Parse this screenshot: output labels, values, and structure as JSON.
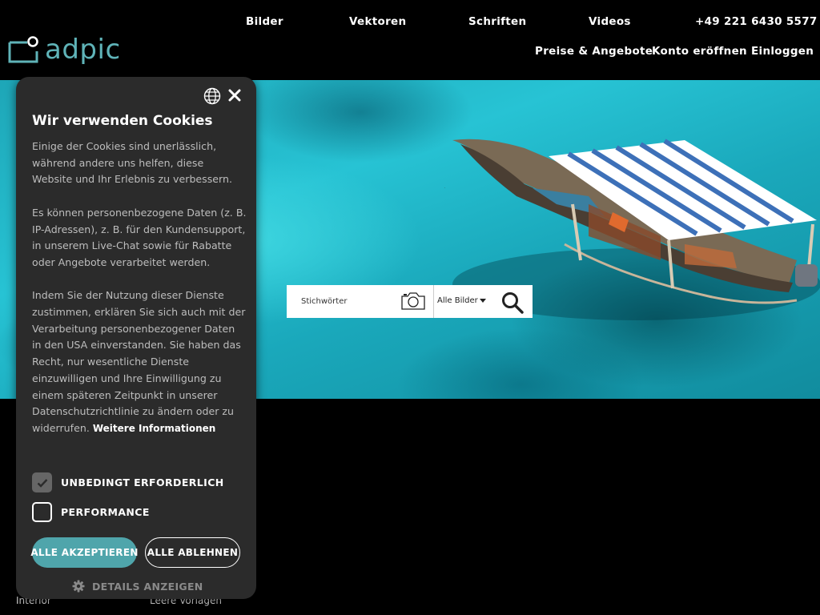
{
  "header": {
    "logo_text": "adpic",
    "nav_top": [
      "Bilder",
      "Vektoren",
      "Schriften",
      "Videos",
      "+49 221 6430 5577"
    ],
    "nav_bottom": [
      "Preise & Angebote",
      "Konto eröffnen",
      "Einloggen"
    ]
  },
  "search": {
    "placeholder": "Stichwörter",
    "category": "Alle Bilder"
  },
  "bottom_links": [
    "Interior",
    "Leere Vorlagen"
  ],
  "cookie": {
    "title": "Wir verwenden Cookies",
    "paragraph1": "Einige der Cookies sind unerlässlich, während andere uns helfen, diese Website und Ihr Erlebnis zu verbessern.",
    "paragraph2": "Es können personenbezogene Daten (z. B. IP-Adressen), z. B. für den Kundensupport, in unserem Live-Chat sowie für Rabatte oder Angebote verarbeitet werden.",
    "paragraph3": "Indem Sie der Nutzung dieser Dienste zustimmen, erklären Sie sich auch mit der Verarbeitung personenbezogener Daten in den USA einverstanden. Sie haben das Recht, nur wesentliche Dienste einzuwilligen und Ihre Einwilligung zu einem späteren Zeitpunkt in unserer Datenschutzrichtlinie zu ändern oder zu widerrufen.",
    "more_info_link": "Weitere Informationen",
    "options": [
      {
        "label": "UNBEDINGT ERFORDERLICH",
        "checked": true,
        "disabled": true
      },
      {
        "label": "PERFORMANCE",
        "checked": false,
        "disabled": false
      }
    ],
    "accept_label": "ALLE AKZEPTIEREN",
    "reject_label": "ALLE ABLEHNEN",
    "details_label": "DETAILS ANZEIGEN"
  },
  "colors": {
    "accent": "#4fa5ab",
    "logo": "#5fb3b8",
    "dialog_bg": "#2b2b2b"
  },
  "icons": [
    "logo-mark-icon",
    "globe-icon",
    "close-icon",
    "camera-icon",
    "search-icon",
    "checkmark-icon",
    "gear-icon",
    "caret-down-icon"
  ]
}
